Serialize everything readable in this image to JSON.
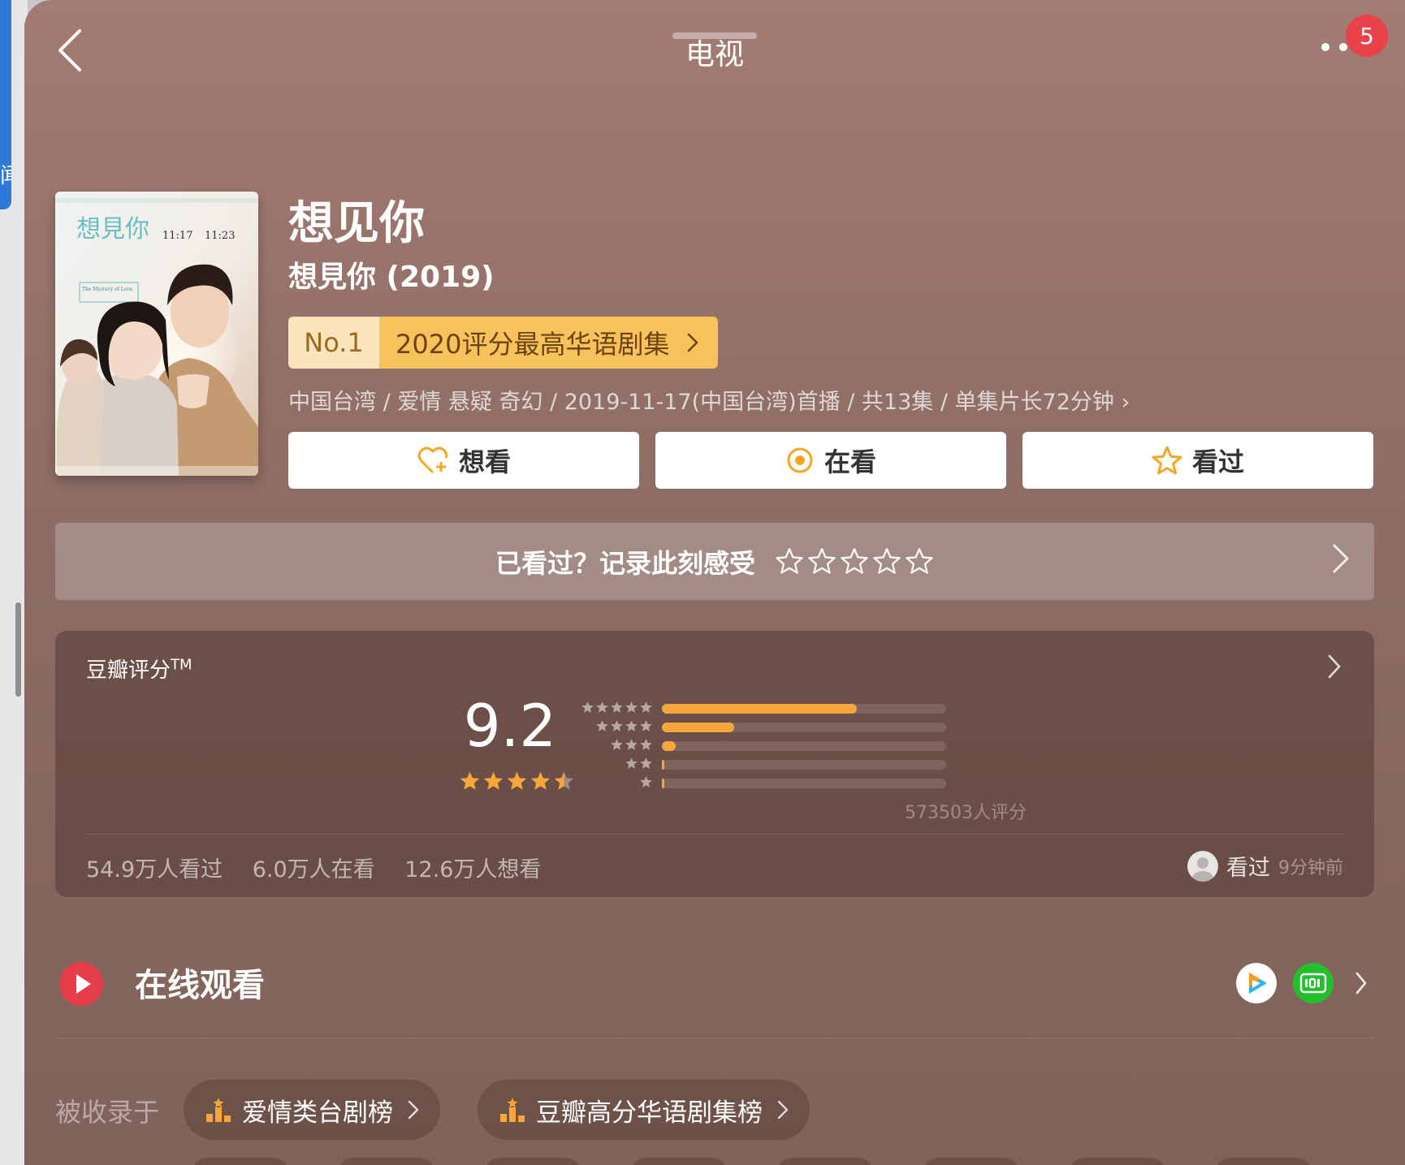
{
  "nav": {
    "title": "电视",
    "notification_count": "5"
  },
  "left_edge": {
    "glyph": "闻"
  },
  "show": {
    "title": "想见你",
    "subtitle": "想見你 (2019)",
    "rank": {
      "no": "No.1",
      "title": "2020评分最高华语剧集"
    },
    "meta": "中国台湾 / 爱情 悬疑 奇幻 / 2019-11-17(中国台湾)首播 / 共13集 / 单集片长72分钟 ›"
  },
  "poster": {
    "title_art": "想見你",
    "slot1_time": "11:17",
    "slot2_time": "11:23",
    "tagline": "The Mystery of Love"
  },
  "actions": [
    {
      "label": "想看",
      "icon": "heart-plus-icon"
    },
    {
      "label": "在看",
      "icon": "target-icon"
    },
    {
      "label": "看过",
      "icon": "star-icon"
    }
  ],
  "rate_prompt": {
    "text": "已看过？记录此刻感受",
    "stars": 5
  },
  "rating": {
    "label": "豆瓣评分",
    "tm": "TM",
    "score": "9.2",
    "stars": 4.5,
    "distribution_percent": [
      68.5,
      25.3,
      4.8,
      0.7,
      0.7
    ],
    "count_text": "573503人评分",
    "stats": [
      "54.9万人看过",
      "6.0万人在看",
      "12.6万人想看"
    ],
    "friend": {
      "status": "看过",
      "time": "9分钟前"
    }
  },
  "online_watch": {
    "title": "在线观看",
    "platforms": [
      {
        "name": "tencent-video-icon",
        "color": "#ffffff"
      },
      {
        "name": "iqiyi-icon",
        "color": "#23c02d"
      }
    ]
  },
  "included_in": {
    "label": "被收录于",
    "charts": [
      "爱情类台剧榜",
      "豆瓣高分华语剧集榜"
    ]
  },
  "colors": {
    "accent": "#f7a63a",
    "badge": "#f7c25c",
    "notif": "#e9424a"
  }
}
